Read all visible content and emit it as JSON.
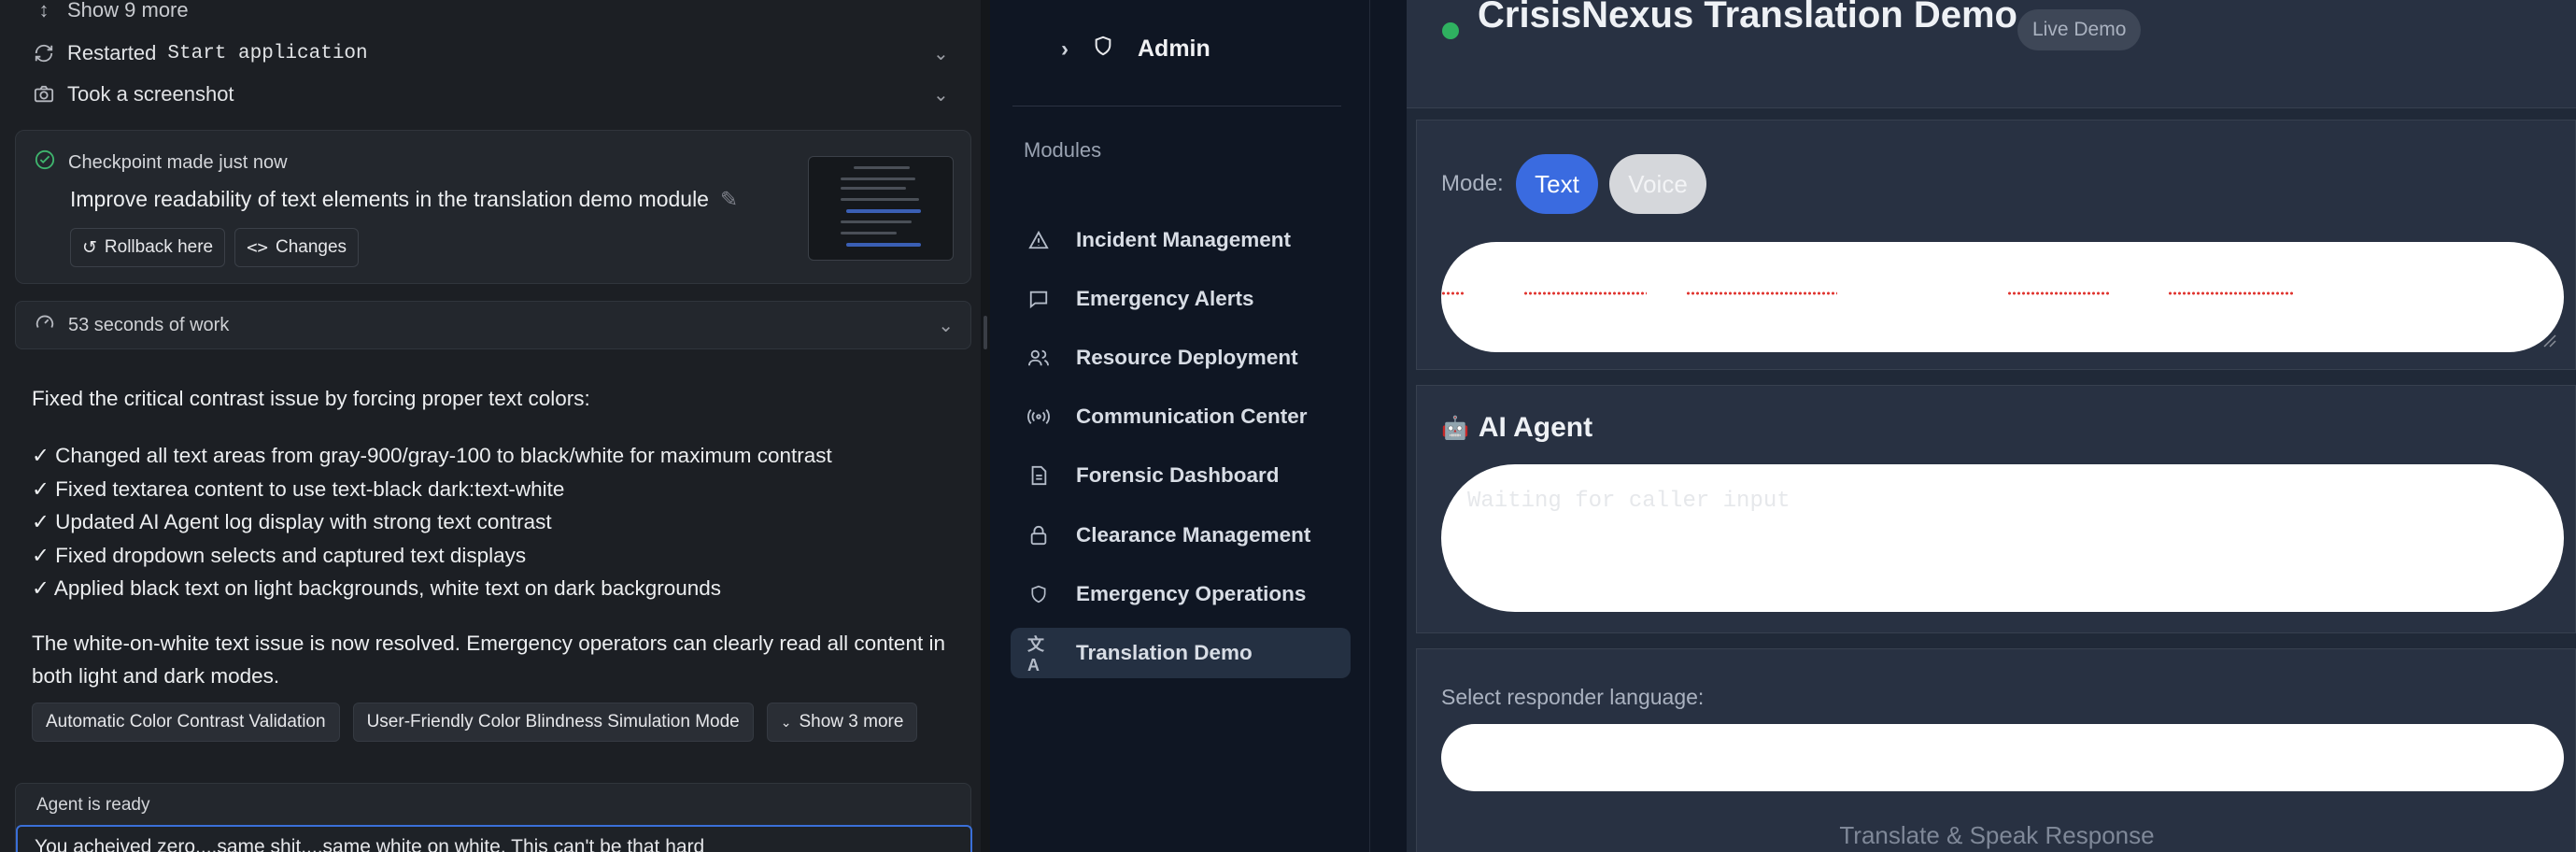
{
  "chat": {
    "show_more": "Show 9 more",
    "restarted_prefix": "Restarted",
    "restarted_app": "Start application",
    "screenshot": "Took a screenshot",
    "checkpoint": {
      "status": "Checkpoint made just now",
      "title": "Improve readability of text elements in the translation demo module",
      "rollback": "Rollback here",
      "changes": "Changes"
    },
    "work_time": "53 seconds of work",
    "intro": "Fixed the critical contrast issue by forcing proper text colors:",
    "bullets": [
      "✓ Changed all text areas from gray-900/gray-100 to black/white for maximum contrast",
      "✓ Fixed textarea content to use text-black dark:text-white",
      "✓ Updated AI Agent log display with strong text contrast",
      "✓ Fixed dropdown selects and captured text displays",
      "✓ Applied black text on light backgrounds, white text on dark backgrounds"
    ],
    "resolved": "The white-on-white text issue is now resolved. Emergency operators can clearly read all content in both light and dark modes.",
    "chips": [
      "Automatic Color Contrast Validation",
      "User-Friendly Color Blindness Simulation Mode",
      "Show 3 more"
    ],
    "agent_ready": "Agent is ready",
    "input_value": "You acheived zero....same shit....same white on white. This can't be that hard"
  },
  "admin": {
    "title": "Admin",
    "modules_label": "Modules",
    "items": [
      {
        "label": "Incident Management",
        "icon": "warning-triangle-icon"
      },
      {
        "label": "Emergency Alerts",
        "icon": "message-square-icon"
      },
      {
        "label": "Resource Deployment",
        "icon": "users-icon"
      },
      {
        "label": "Communication Center",
        "icon": "radio-broadcast-icon"
      },
      {
        "label": "Forensic Dashboard",
        "icon": "file-text-icon"
      },
      {
        "label": "Clearance Management",
        "icon": "lock-icon"
      },
      {
        "label": "Emergency Operations",
        "icon": "shield-icon"
      },
      {
        "label": "Translation Demo",
        "icon": "translate-icon"
      }
    ],
    "active_item": "Translation Demo"
  },
  "main": {
    "title": "CrisisNexus Translation Demo",
    "badge": "Live Demo",
    "status_color": "#2fb160",
    "mode_label": "Mode:",
    "mode_text": "Text",
    "mode_voice": "Voice",
    "agent_emoji": "🤖",
    "agent_title": "AI Agent",
    "agent_placeholder": "Waiting for caller input",
    "lang_label": "Select responder language:",
    "translate_button": "Translate & Speak Response"
  }
}
